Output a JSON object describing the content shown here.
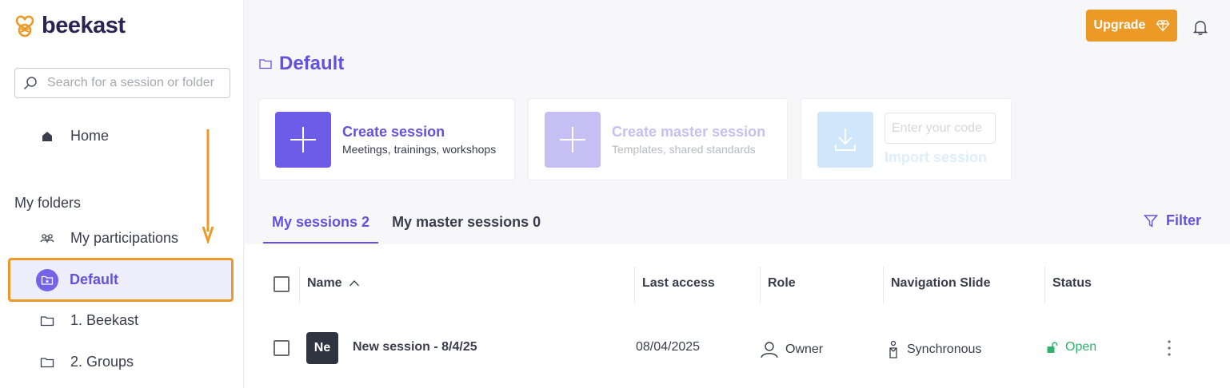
{
  "app": {
    "name": "beekast"
  },
  "sidebar": {
    "search_placeholder": "Search for a session or folder",
    "home_label": "Home",
    "folders_title": "My folders",
    "items": [
      {
        "label": "My participations",
        "icon": "participants-icon"
      },
      {
        "label": "Default",
        "icon": "star-folder-icon",
        "active": true
      },
      {
        "label": "1. Beekast",
        "icon": "folder-icon"
      },
      {
        "label": "2. Groups",
        "icon": "folder-icon"
      }
    ]
  },
  "header": {
    "upgrade_label": "Upgrade"
  },
  "page": {
    "title": "Default"
  },
  "actions": {
    "create": {
      "title": "Create session",
      "subtitle": "Meetings, trainings, workshops"
    },
    "master": {
      "title": "Create master session",
      "subtitle": "Templates, shared standards"
    },
    "import": {
      "code_placeholder": "Enter your code",
      "label": "Import session"
    }
  },
  "tabs": [
    {
      "label": "My sessions 2",
      "active": true
    },
    {
      "label": "My master sessions 0",
      "active": false
    }
  ],
  "filter_label": "Filter",
  "table": {
    "columns": [
      "Name",
      "Last access",
      "Role",
      "Navigation Slide",
      "Status"
    ],
    "rows": [
      {
        "avatar": "Ne",
        "name": "New session - 8/4/25",
        "last_access": "08/04/2025",
        "role": "Owner",
        "navigation": "Synchronous",
        "status": "Open"
      }
    ]
  },
  "colors": {
    "accent": "#6352e0",
    "brand_orange": "#ec9a27",
    "status_open": "#2fb36c"
  }
}
